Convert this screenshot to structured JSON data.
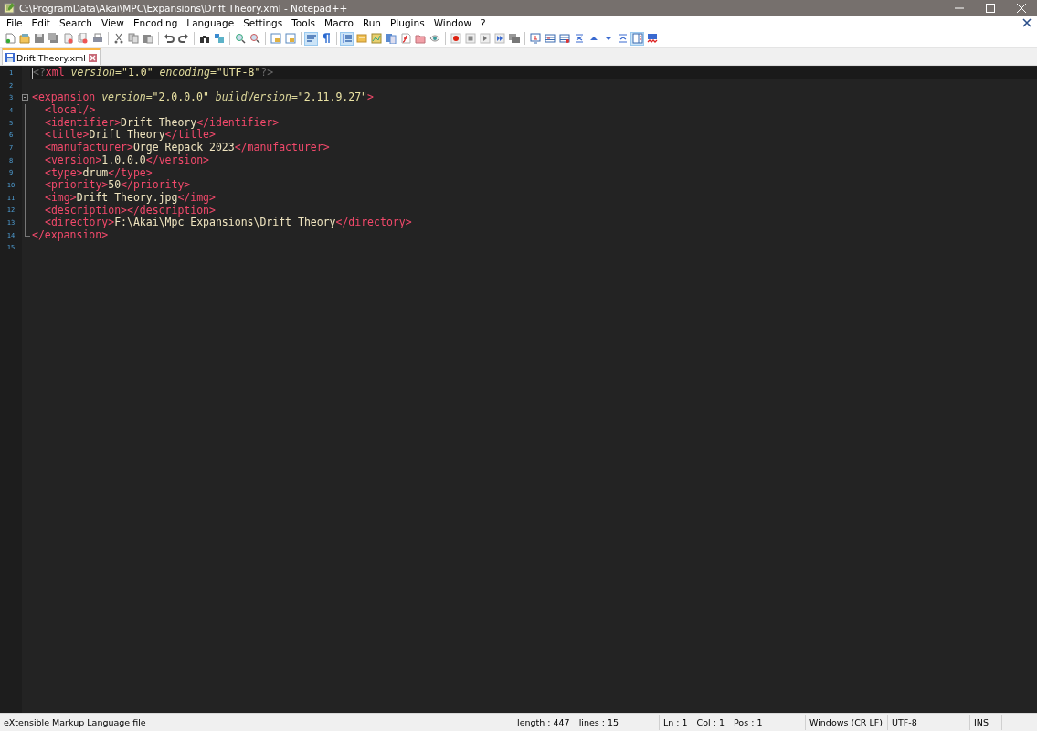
{
  "window": {
    "title": "C:\\ProgramData\\Akai\\MPC\\Expansions\\Drift Theory.xml - Notepad++"
  },
  "menu": [
    "File",
    "Edit",
    "Search",
    "View",
    "Encoding",
    "Language",
    "Settings",
    "Tools",
    "Macro",
    "Run",
    "Plugins",
    "Window",
    "?"
  ],
  "toolbar_buttons": [
    {
      "pressed": false
    },
    {
      "pressed": false
    },
    {
      "pressed": false
    },
    {
      "pressed": false
    },
    {
      "pressed": false
    },
    {
      "pressed": false
    },
    {
      "pressed": false
    },
    {
      "pressed": false
    },
    {
      "pressed": false
    },
    {
      "pressed": false
    },
    {
      "pressed": false
    },
    {
      "pressed": false
    },
    {
      "pressed": false
    },
    {
      "pressed": false
    },
    {
      "pressed": false
    },
    {
      "pressed": false
    },
    {
      "pressed": false
    },
    {
      "pressed": false
    },
    {
      "pressed": true
    },
    {
      "pressed": false
    },
    {
      "pressed": true
    },
    {
      "pressed": false
    },
    {
      "pressed": false
    },
    {
      "pressed": false
    },
    {
      "pressed": false
    },
    {
      "pressed": false
    },
    {
      "pressed": false
    },
    {
      "pressed": false
    },
    {
      "pressed": false
    },
    {
      "pressed": false
    },
    {
      "pressed": false
    },
    {
      "pressed": false
    },
    {
      "pressed": false
    },
    {
      "pressed": false
    },
    {
      "pressed": false
    },
    {
      "pressed": false
    },
    {
      "pressed": false
    },
    {
      "pressed": false
    },
    {
      "pressed": false
    },
    {
      "pressed": true
    }
  ],
  "tabs": [
    {
      "label": "Drift Theory.xml",
      "selected": true
    }
  ],
  "lines": [
    {
      "number": "1",
      "current": true,
      "tokens": [
        {
          "kind": "pi",
          "text": "<?"
        },
        {
          "kind": "tag",
          "text": "xml"
        },
        {
          "kind": "attr",
          "text": " version"
        },
        {
          "kind": "eq",
          "text": "="
        },
        {
          "kind": "string",
          "text": "\"1.0\""
        },
        {
          "kind": "attr",
          "text": " encoding"
        },
        {
          "kind": "eq",
          "text": "="
        },
        {
          "kind": "string",
          "text": "\"UTF-8\""
        },
        {
          "kind": "pi",
          "text": "?>"
        }
      ]
    },
    {
      "number": "2",
      "current": false
    },
    {
      "number": "3",
      "current": false,
      "expanded": true,
      "tokens": [
        {
          "kind": "tag",
          "text": "<expansion"
        },
        {
          "kind": "attr",
          "text": " version"
        },
        {
          "kind": "eq",
          "text": "="
        },
        {
          "kind": "string",
          "text": "\"2.0.0.0\""
        },
        {
          "kind": "attr",
          "text": " buildVersion"
        },
        {
          "kind": "eq",
          "text": "="
        },
        {
          "kind": "string",
          "text": "\"2.11.9.27\""
        },
        {
          "kind": "tag",
          "text": ">"
        }
      ],
      "children": [
        {
          "number": "4",
          "current": false,
          "tokens": [
            {
              "kind": "tag",
              "text": "<local/>"
            }
          ]
        },
        {
          "number": "5",
          "current": false,
          "tokens": [
            {
              "kind": "tag",
              "text": "<identifier>"
            },
            {
              "kind": "text",
              "text": "Drift Theory"
            },
            {
              "kind": "tag",
              "text": "</identifier>"
            }
          ]
        },
        {
          "number": "6",
          "current": false,
          "tokens": [
            {
              "kind": "tag",
              "text": "<title>"
            },
            {
              "kind": "text",
              "text": "Drift Theory"
            },
            {
              "kind": "tag",
              "text": "</title>"
            }
          ]
        },
        {
          "number": "7",
          "current": false,
          "tokens": [
            {
              "kind": "tag",
              "text": "<manufacturer>"
            },
            {
              "kind": "text",
              "text": "Orge Repack 2023"
            },
            {
              "kind": "tag",
              "text": "</manufacturer>"
            }
          ]
        },
        {
          "number": "8",
          "current": false,
          "tokens": [
            {
              "kind": "tag",
              "text": "<version>"
            },
            {
              "kind": "text",
              "text": "1.0.0.0"
            },
            {
              "kind": "tag",
              "text": "</version>"
            }
          ]
        },
        {
          "number": "9",
          "current": false,
          "tokens": [
            {
              "kind": "tag",
              "text": "<type>"
            },
            {
              "kind": "text",
              "text": "drum"
            },
            {
              "kind": "tag",
              "text": "</type>"
            }
          ]
        },
        {
          "number": "10",
          "current": false,
          "tokens": [
            {
              "kind": "tag",
              "text": "<priority>"
            },
            {
              "kind": "text",
              "text": "50"
            },
            {
              "kind": "tag",
              "text": "</priority>"
            }
          ]
        },
        {
          "number": "11",
          "current": false,
          "tokens": [
            {
              "kind": "tag",
              "text": "<img>"
            },
            {
              "kind": "text",
              "text": "Drift Theory.jpg"
            },
            {
              "kind": "tag",
              "text": "</img>"
            }
          ]
        },
        {
          "number": "12",
          "current": false,
          "tokens": [
            {
              "kind": "tag",
              "text": "<description></description>"
            }
          ]
        },
        {
          "number": "13",
          "current": false,
          "tokens": [
            {
              "kind": "tag",
              "text": "<directory>"
            },
            {
              "kind": "text",
              "text": "F:\\Akai\\Mpc Expansions\\Drift Theory"
            },
            {
              "kind": "tag",
              "text": "</directory>"
            }
          ]
        }
      ]
    },
    {
      "number": "14",
      "current": false,
      "fold_end": true,
      "tokens": [
        {
          "kind": "tag",
          "text": "</expansion>"
        }
      ]
    },
    {
      "number": "15",
      "current": false
    }
  ],
  "status_bar": [
    {
      "kind": "wide",
      "items": [
        "eXtensible Markup Language file"
      ]
    },
    {
      "kind": "normal",
      "items": [
        "length : 447",
        "lines : 15"
      ]
    },
    {
      "kind": "normal",
      "items": [
        "Ln : 1",
        "Col : 1",
        "Pos : 1"
      ]
    },
    {
      "kind": "small",
      "items": [
        "Windows (CR LF)"
      ]
    },
    {
      "kind": "small",
      "items": [
        "UTF-8"
      ]
    },
    {
      "kind": "tiny",
      "items": [
        "INS"
      ]
    }
  ]
}
